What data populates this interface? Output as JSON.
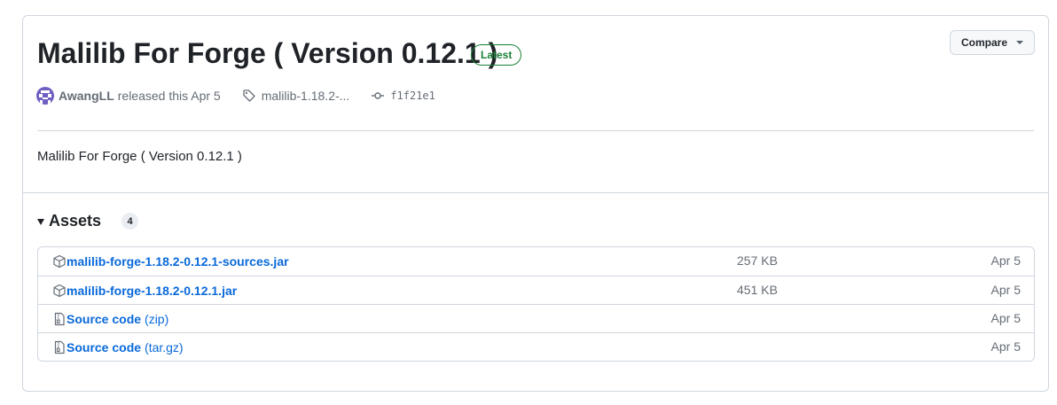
{
  "release": {
    "title": "Malilib For Forge ( Version 0.12.1 )",
    "badge": "Latest",
    "compare_label": "Compare",
    "author": "AwangLL",
    "released_text": "released this Apr 5",
    "tag": "malilib-1.18.2-...",
    "commit": "f1f21e1",
    "body": "Malilib For Forge ( Version 0.12.1 )"
  },
  "assets": {
    "label": "Assets",
    "count": "4",
    "items": [
      {
        "name": "malilib-forge-1.18.2-0.12.1-sources.jar",
        "suffix": "",
        "size": "257 KB",
        "date": "Apr 5",
        "icon": "package-icon"
      },
      {
        "name": "malilib-forge-1.18.2-0.12.1.jar",
        "suffix": "",
        "size": "451 KB",
        "date": "Apr 5",
        "icon": "package-icon"
      },
      {
        "name": "Source code",
        "suffix": "(zip)",
        "size": "",
        "date": "Apr 5",
        "icon": "file-zip-icon"
      },
      {
        "name": "Source code",
        "suffix": "(tar.gz)",
        "size": "",
        "date": "Apr 5",
        "icon": "file-zip-icon"
      }
    ]
  },
  "colors": {
    "link": "#0969da",
    "latest_green": "#1a7f37",
    "muted": "#656d76",
    "border": "#d0d7de"
  }
}
